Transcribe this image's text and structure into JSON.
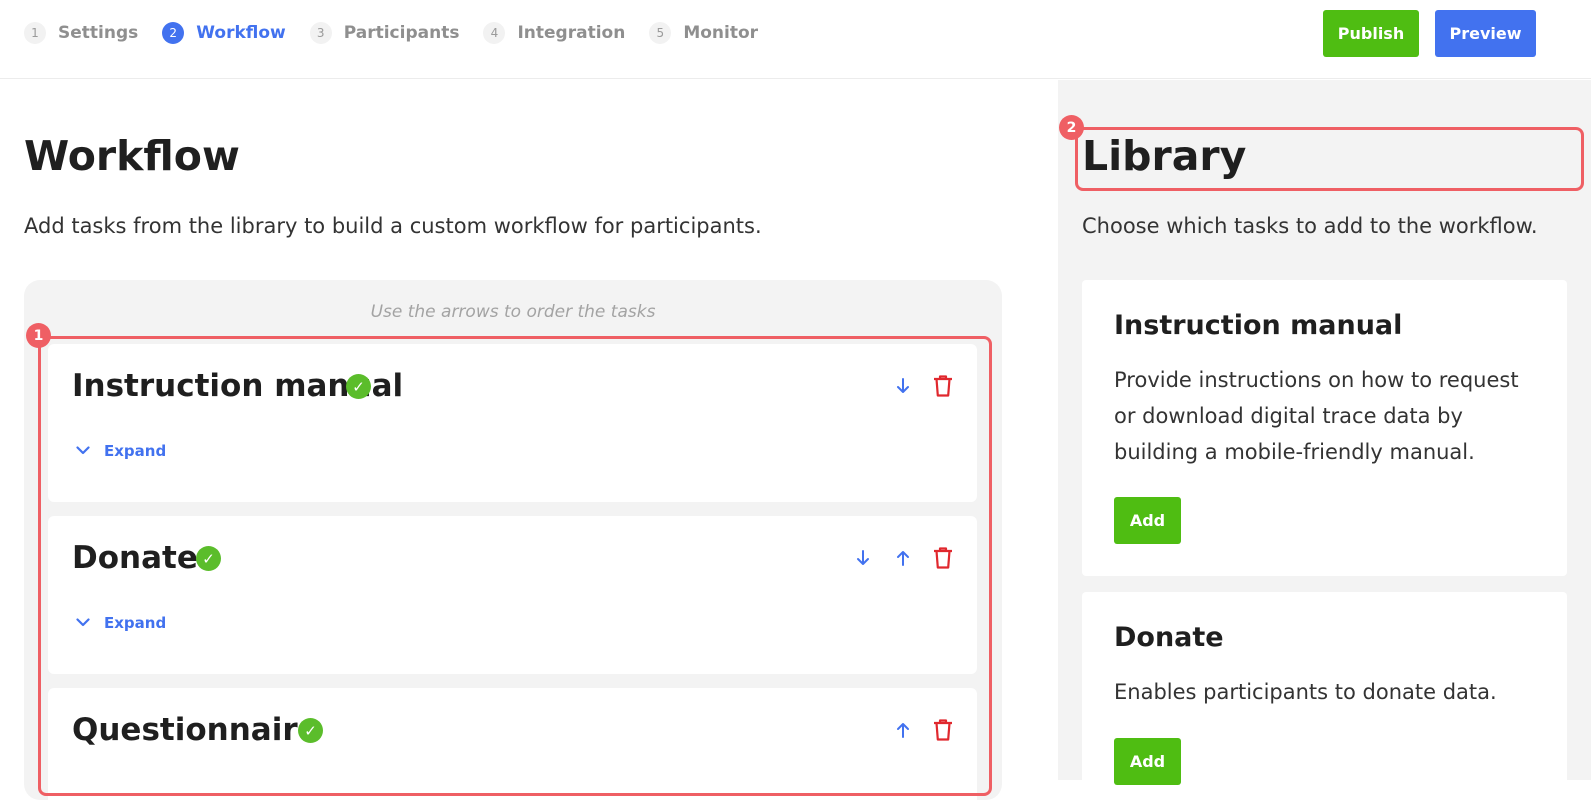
{
  "stepper": {
    "steps": [
      {
        "num": "1",
        "label": "Settings"
      },
      {
        "num": "2",
        "label": "Workflow"
      },
      {
        "num": "3",
        "label": "Participants"
      },
      {
        "num": "4",
        "label": "Integration"
      },
      {
        "num": "5",
        "label": "Monitor"
      }
    ],
    "active_step": 2
  },
  "header": {
    "publish_label": "Publish",
    "preview_label": "Preview"
  },
  "workflow": {
    "title": "Workflow",
    "description": "Add tasks from the library to build a custom workflow for participants.",
    "hint": "Use the arrows to order the tasks",
    "tasks": [
      {
        "title": "Instruction manual",
        "expand_label": "Expand",
        "status": "complete"
      },
      {
        "title": "Donate",
        "expand_label": "Expand",
        "status": "complete"
      },
      {
        "title": "Questionnaire",
        "status": "complete"
      }
    ]
  },
  "library": {
    "title": "Library",
    "description": "Choose which tasks to add to the workflow.",
    "items": [
      {
        "title": "Instruction manual",
        "description": "Provide instructions on how to request or download digital trace data by building a mobile-friendly manual.",
        "add_label": "Add"
      },
      {
        "title": "Donate",
        "description": "Enables participants to donate data.",
        "add_label": "Add"
      }
    ]
  },
  "annotations": {
    "badge_1": "1",
    "badge_2": "2"
  },
  "colors": {
    "primary": "#4272ef",
    "success": "#4fbd12",
    "check": "#5bbd2b",
    "danger": "#e0282e",
    "highlight": "#ef5f64"
  }
}
